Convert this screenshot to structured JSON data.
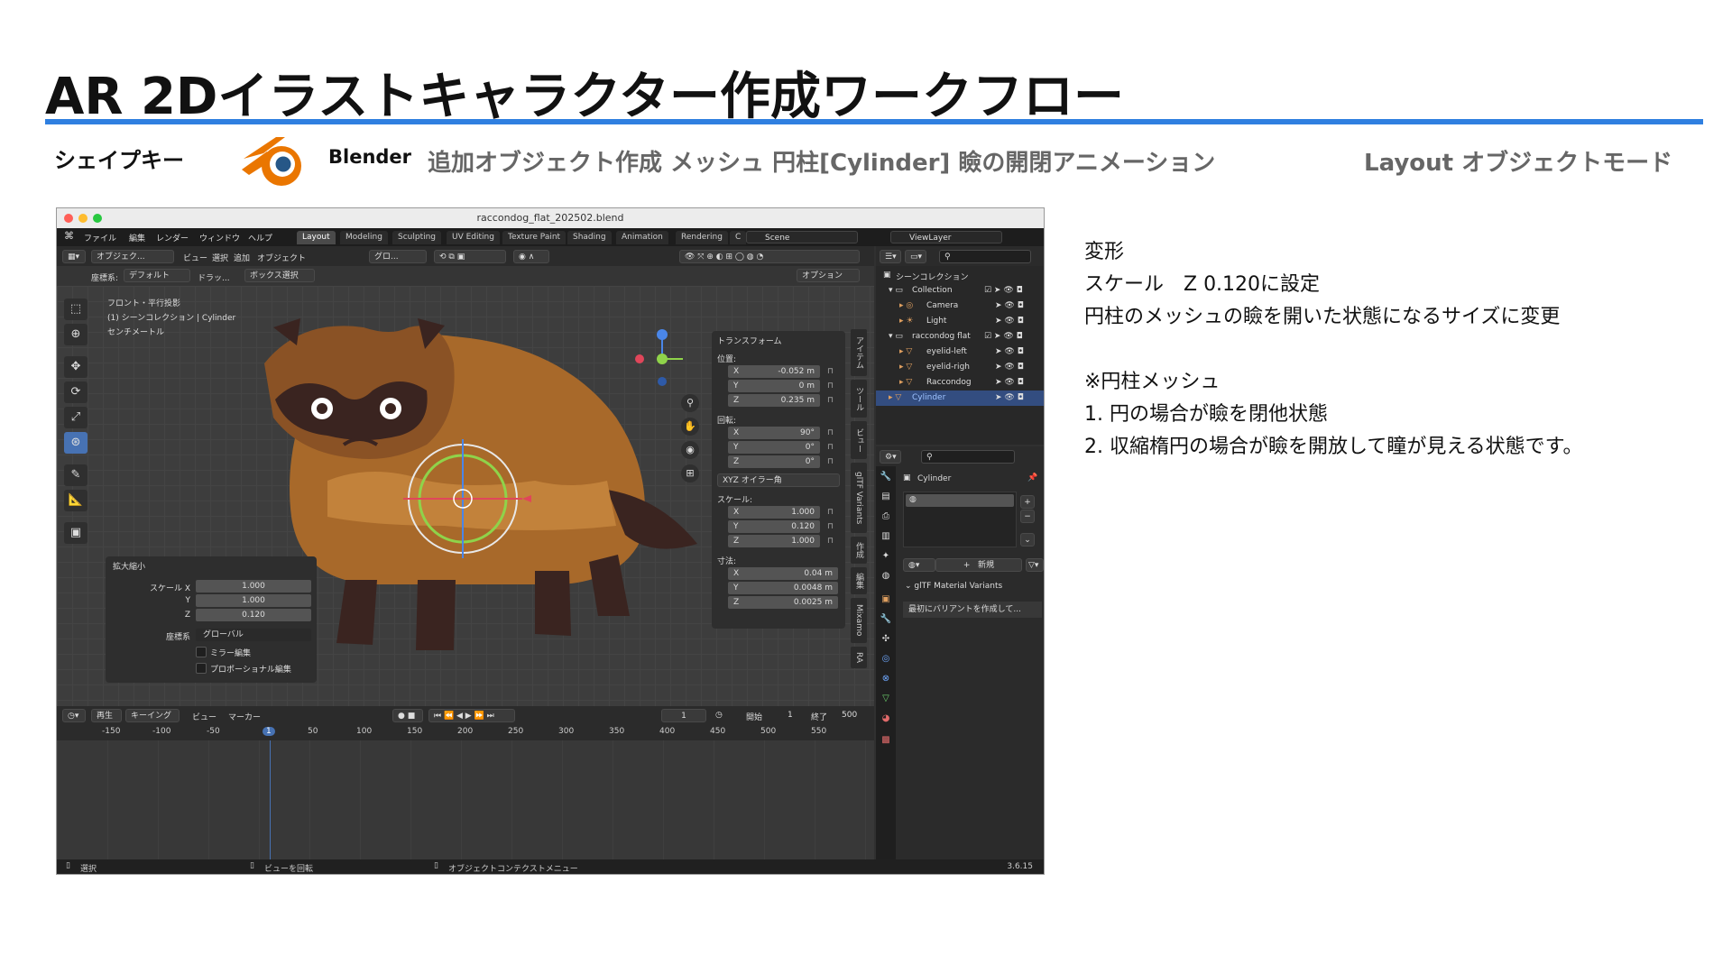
{
  "slide": {
    "title": "AR 2Dイラストキャラクター作成ワークフロー",
    "section": "シェイプキー",
    "app_label": "Blender",
    "path": "追加オブジェクト作成 メッシュ 円柱[Cylinder] 瞼の開閉アニメーション",
    "mode": "Layout オブジェクトモード",
    "accent_color": "#2f7fe0",
    "notes": [
      "変形",
      "スケール　Z 0.120に設定",
      "円柱のメッシュの瞼を開いた状態になるサイズに変更",
      "",
      "※円柱メッシュ",
      "1. 円の場合が瞼を閉他状態",
      "2. 収縮楕円の場合が瞼を開放して瞳が見える状態です。"
    ]
  },
  "blender": {
    "window_title": "raccondog_flat_202502.blend",
    "menu": [
      "ファイル",
      "編集",
      "レンダー",
      "ウィンドウ",
      "ヘルプ"
    ],
    "workspaces": [
      "Layout",
      "Modeling",
      "Sculpting",
      "UV Editing",
      "Texture Paint",
      "Shading",
      "Animation",
      "Rendering",
      "C"
    ],
    "active_workspace": "Layout",
    "scene": "Scene",
    "view_layer": "ViewLayer",
    "viewport_header": {
      "mode": "オブジェク...",
      "items": [
        "ビュー",
        "選択",
        "追加",
        "オブジェクト"
      ],
      "orientation": "グロ...",
      "coord_label": "座標系:",
      "coord_value": "デフォルト",
      "drag_label": "ドラッ...",
      "select_box": "ボックス選択",
      "options": "オプション"
    },
    "viewport_info": [
      "フロント・平行投影",
      "(1) シーンコレクション | Cylinder",
      "センチメートル"
    ],
    "n_panel": {
      "title": "トランスフォーム",
      "location_label": "位置:",
      "location": [
        {
          "axis": "X",
          "value": "-0.052 m"
        },
        {
          "axis": "Y",
          "value": "0 m"
        },
        {
          "axis": "Z",
          "value": "0.235 m"
        }
      ],
      "rotation_label": "回転:",
      "rotation": [
        {
          "axis": "X",
          "value": "90°"
        },
        {
          "axis": "Y",
          "value": "0°"
        },
        {
          "axis": "Z",
          "value": "0°"
        }
      ],
      "rotation_mode": "XYZ オイラー角",
      "scale_label": "スケール:",
      "scale": [
        {
          "axis": "X",
          "value": "1.000"
        },
        {
          "axis": "Y",
          "value": "0.120"
        },
        {
          "axis": "Z",
          "value": "1.000"
        }
      ],
      "dimensions_label": "寸法:",
      "dimensions": [
        {
          "axis": "X",
          "value": "0.04 m"
        },
        {
          "axis": "Y",
          "value": "0.0048 m"
        },
        {
          "axis": "Z",
          "value": "0.0025 m"
        }
      ]
    },
    "side_tabs": [
      "アイテム",
      "ツール",
      "ビュー",
      "glTF Variants",
      "作成",
      "編集",
      "Mixamo",
      "RA"
    ],
    "last_operator": {
      "title": "拡大縮小",
      "rows": [
        {
          "label": "スケール X",
          "value": "1.000"
        },
        {
          "label": "Y",
          "value": "1.000"
        },
        {
          "label": "Z",
          "value": "0.120"
        }
      ],
      "orientation_label": "座標系",
      "orientation_value": "グローバル",
      "mirror": "ミラー編集",
      "proportional": "プロポーショナル編集"
    },
    "timeline": {
      "playback": "再生",
      "keying": "キーイング",
      "view": "ビュー",
      "marker": "マーカー",
      "current_frame": "1",
      "start_label": "開始",
      "start": "1",
      "end_label": "終了",
      "end": "500",
      "ticks": [
        "-150",
        "-100",
        "-50",
        "1",
        "50",
        "100",
        "150",
        "200",
        "250",
        "300",
        "350",
        "400",
        "450",
        "500",
        "550"
      ]
    },
    "status_bar": [
      "選択",
      "ビューを回転",
      "オブジェクトコンテクストメニュー"
    ],
    "version": "3.6.15",
    "outliner": {
      "root": "シーンコレクション",
      "items": [
        {
          "name": "Collection",
          "level": 1
        },
        {
          "name": "Camera",
          "level": 2
        },
        {
          "name": "Light",
          "level": 2
        },
        {
          "name": "raccondog flat",
          "level": 1
        },
        {
          "name": "eyelid-left",
          "level": 2
        },
        {
          "name": "eyelid-righ",
          "level": 2
        },
        {
          "name": "Raccondog",
          "level": 2
        },
        {
          "name": "Cylinder",
          "level": 1
        }
      ],
      "selected": "Cylinder"
    },
    "properties": {
      "object_name": "Cylinder",
      "new_label": "新規",
      "gltf_section": "glTF Material Variants",
      "gltf_hint": "最初にバリアントを作成して..."
    }
  }
}
